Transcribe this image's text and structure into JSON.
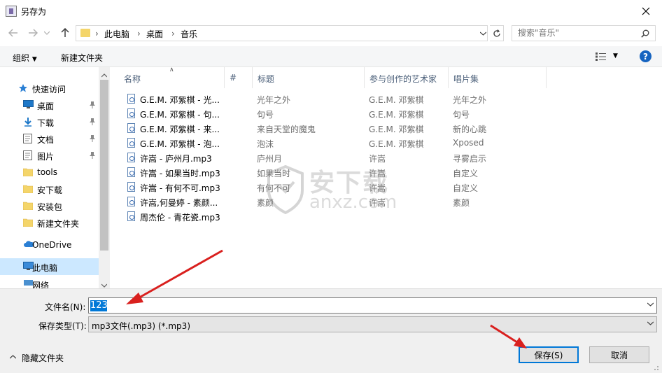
{
  "window": {
    "title": "另存为"
  },
  "address": {
    "crumbs": [
      "此电脑",
      "桌面",
      "音乐"
    ]
  },
  "search": {
    "placeholder": "搜索\"音乐\""
  },
  "toolbar": {
    "organize": "组织",
    "new_folder": "新建文件夹"
  },
  "sidebar": {
    "items": [
      {
        "label": "快速访问",
        "icon": "star-icon"
      },
      {
        "label": "桌面",
        "icon": "desktop-icon",
        "pinned": true
      },
      {
        "label": "下载",
        "icon": "download-icon",
        "pinned": true
      },
      {
        "label": "文档",
        "icon": "document-icon",
        "pinned": true
      },
      {
        "label": "图片",
        "icon": "picture-icon",
        "pinned": true
      },
      {
        "label": "tools",
        "icon": "folder-icon"
      },
      {
        "label": "安下载",
        "icon": "folder-icon"
      },
      {
        "label": "安装包",
        "icon": "folder-icon"
      },
      {
        "label": "新建文件夹",
        "icon": "folder-icon"
      },
      {
        "label": "OneDrive",
        "icon": "cloud-icon"
      },
      {
        "label": "此电脑",
        "icon": "computer-icon",
        "selected": true
      },
      {
        "label": "网络",
        "icon": "network-icon"
      }
    ]
  },
  "columns": {
    "name": "名称",
    "num": "#",
    "title": "标题",
    "artist": "参与创作的艺术家",
    "album": "唱片集"
  },
  "files": [
    {
      "name": "G.E.M. 邓紫棋 - 光...",
      "title": "光年之外",
      "artist": "G.E.M. 邓紫棋",
      "album": "光年之外"
    },
    {
      "name": "G.E.M. 邓紫棋 - 句...",
      "title": "句号",
      "artist": "G.E.M. 邓紫棋",
      "album": "句号"
    },
    {
      "name": "G.E.M. 邓紫棋 - 来...",
      "title": "来自天堂的魔鬼",
      "artist": "G.E.M. 邓紫棋",
      "album": "新的心跳"
    },
    {
      "name": "G.E.M. 邓紫棋 - 泡...",
      "title": "泡沫",
      "artist": "G.E.M. 邓紫棋",
      "album": "Xposed"
    },
    {
      "name": "许嵩 - 庐州月.mp3",
      "title": "庐州月",
      "artist": "许嵩",
      "album": "寻雾启示"
    },
    {
      "name": "许嵩 - 如果当时.mp3",
      "title": "如果当时",
      "artist": "许嵩",
      "album": "自定义"
    },
    {
      "name": "许嵩 - 有何不可.mp3",
      "title": "有何不可",
      "artist": "许嵩",
      "album": "自定义"
    },
    {
      "name": "许嵩,何曼婷 - 素颜...",
      "title": "素颜",
      "artist": "许嵩",
      "album": "素颜"
    },
    {
      "name": "周杰伦 - 青花瓷.mp3",
      "title": "",
      "artist": "",
      "album": ""
    }
  ],
  "form": {
    "filename_label": "文件名(N):",
    "filename_value": "123",
    "filetype_label": "保存类型(T):",
    "filetype_value": "mp3文件(.mp3) (*.mp3)"
  },
  "footer": {
    "hide_folders": "隐藏文件夹",
    "save": "保存(S)",
    "cancel": "取消"
  },
  "watermark": {
    "text1": "安下载",
    "text2": "anxz.com"
  },
  "colors": {
    "accent": "#0078d7",
    "arrow": "#d9201e",
    "folder": "#f4d56a"
  }
}
